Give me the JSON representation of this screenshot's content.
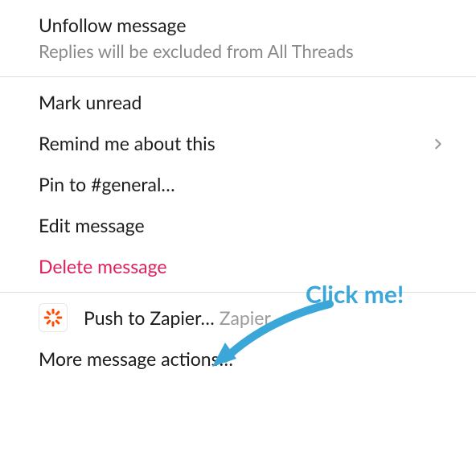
{
  "colors": {
    "text": "#1d1c1d",
    "muted": "#8a8a8a",
    "delete": "#e01e5a",
    "divider": "#dddddd",
    "callout": "#3aa7d8",
    "zapier_orange": "#ff4a00"
  },
  "section1": {
    "unfollow": {
      "label": "Unfollow message",
      "subtitle": "Replies will be excluded from All Threads"
    }
  },
  "section2": {
    "mark_unread": {
      "label": "Mark unread"
    },
    "remind": {
      "label": "Remind me about this",
      "has_submenu": true
    },
    "pin": {
      "label": "Pin to #general…"
    },
    "edit": {
      "label": "Edit message"
    },
    "delete": {
      "label": "Delete message"
    }
  },
  "section3": {
    "push_zapier": {
      "label": "Push to Zapier…",
      "app_name": "Zapier",
      "icon": "zapier-icon"
    },
    "more_actions": {
      "label": "More message actions…"
    }
  },
  "annotation": {
    "text": "Click me!"
  }
}
